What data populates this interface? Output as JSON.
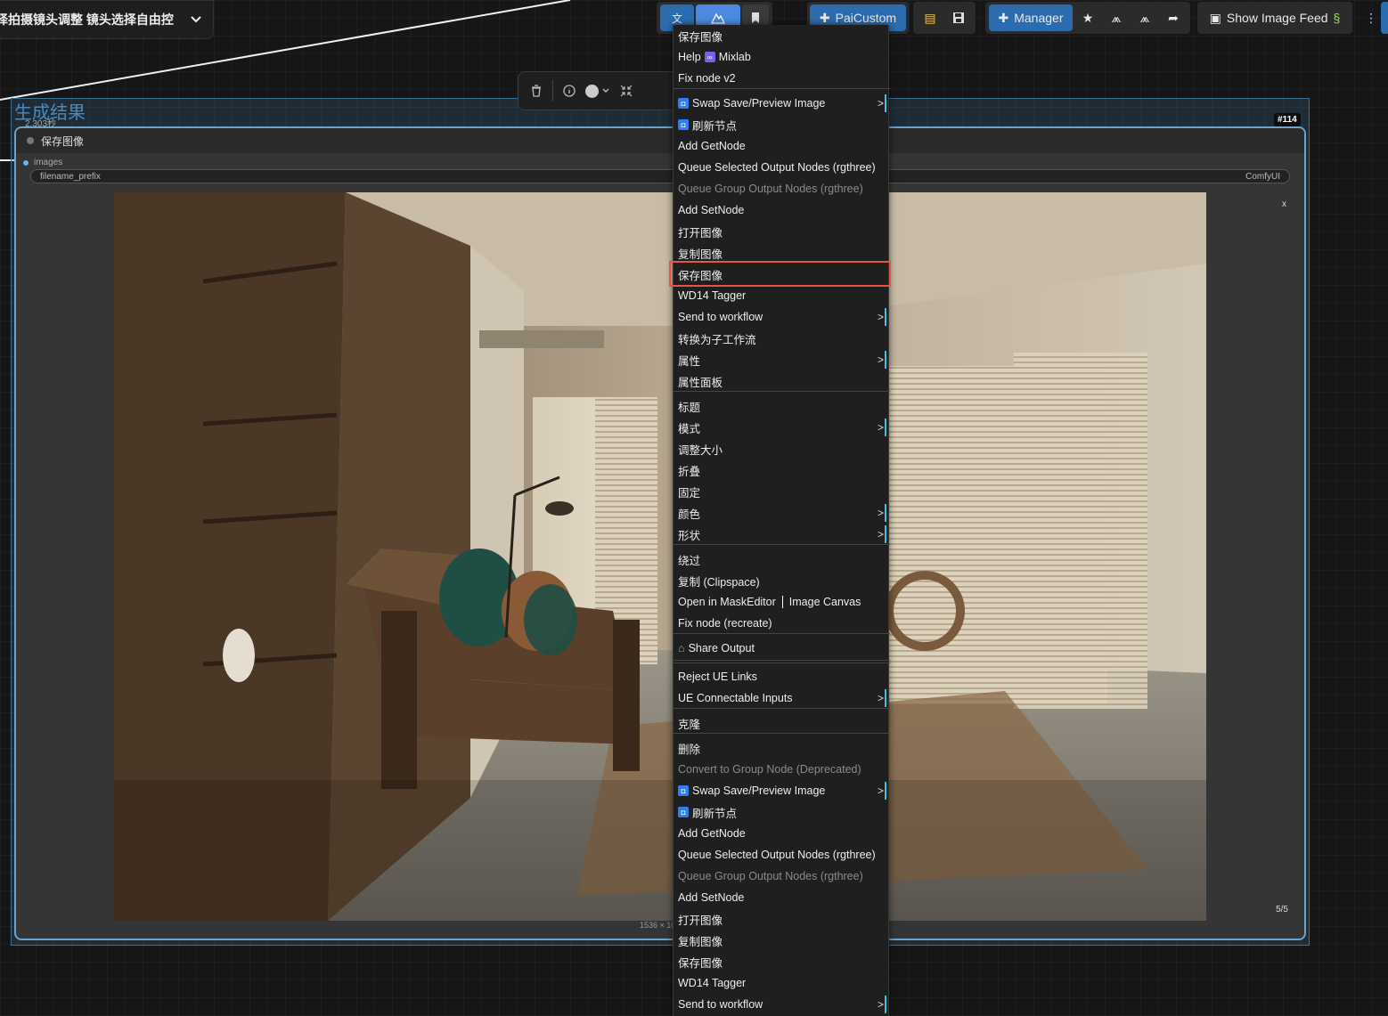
{
  "workflow": {
    "title": "择拍摄镜头调整 镜头选择自由控"
  },
  "toolbar": {
    "translate_icon": "translate-icon",
    "paicustom_label": "PaiCustom",
    "manager_label": "Manager",
    "show_image_feed_label": "Show Image Feed"
  },
  "group": {
    "title": "生成结果",
    "time": "2.303秒"
  },
  "node": {
    "id_badge": "#114",
    "title": "保存图像",
    "input_label": "images",
    "widget_name": "filename_prefix",
    "widget_value": "ComfyUI",
    "close_label": "x",
    "counter": "5/5",
    "image_size": "1536 × 10"
  },
  "menu": {
    "items": [
      {
        "label": "保存图像",
        "disabled": false,
        "submenu": false,
        "icon": null
      },
      {
        "label": "Help",
        "suffix": "Mixlab",
        "disabled": false,
        "submenu": false,
        "icon": "mixlab"
      },
      {
        "label": "Fix node v2",
        "disabled": false,
        "submenu": false,
        "icon": null
      },
      {
        "label": "Swap Save/Preview Image",
        "disabled": false,
        "submenu": true,
        "icon": "blue"
      },
      {
        "label": "刷新节点",
        "disabled": false,
        "submenu": false,
        "icon": "blue"
      },
      {
        "label": "Add GetNode",
        "disabled": false,
        "submenu": false,
        "icon": null
      },
      {
        "label": "Queue Selected Output Nodes (rgthree)",
        "disabled": false,
        "submenu": false,
        "icon": null
      },
      {
        "label": "Queue Group Output Nodes (rgthree)",
        "disabled": true,
        "submenu": false,
        "icon": null
      },
      {
        "label": "Add SetNode",
        "disabled": false,
        "submenu": false,
        "icon": null
      },
      {
        "label": "打开图像",
        "disabled": false,
        "submenu": false,
        "icon": null
      },
      {
        "label": "复制图像",
        "disabled": false,
        "submenu": false,
        "icon": null
      },
      {
        "label": "保存图像",
        "disabled": false,
        "submenu": false,
        "icon": null,
        "highlighted": true
      },
      {
        "label": "WD14 Tagger",
        "disabled": false,
        "submenu": false,
        "icon": null
      },
      {
        "label": "Send to workflow",
        "disabled": false,
        "submenu": true,
        "icon": null
      },
      {
        "label": "转换为子工作流",
        "disabled": false,
        "submenu": false,
        "icon": null
      },
      {
        "label": "属性",
        "disabled": false,
        "submenu": true,
        "icon": null
      },
      {
        "label": "属性面板",
        "disabled": false,
        "submenu": false,
        "icon": null
      },
      {
        "label": "标题",
        "disabled": false,
        "submenu": false,
        "icon": null
      },
      {
        "label": "模式",
        "disabled": false,
        "submenu": true,
        "icon": null
      },
      {
        "label": "调整大小",
        "disabled": false,
        "submenu": false,
        "icon": null
      },
      {
        "label": "折叠",
        "disabled": false,
        "submenu": false,
        "icon": null
      },
      {
        "label": "固定",
        "disabled": false,
        "submenu": false,
        "icon": null
      },
      {
        "label": "颜色",
        "disabled": false,
        "submenu": true,
        "icon": null
      },
      {
        "label": "形状",
        "disabled": false,
        "submenu": true,
        "icon": null
      },
      {
        "label": "绕过",
        "disabled": false,
        "submenu": false,
        "icon": null
      },
      {
        "label": "复制 (Clipspace)",
        "disabled": false,
        "submenu": false,
        "icon": null
      },
      {
        "label": "Open in MaskEditor",
        "suffix": "Image Canvas",
        "disabled": false,
        "submenu": false,
        "icon": "pipe"
      },
      {
        "label": "Fix node (recreate)",
        "disabled": false,
        "submenu": false,
        "icon": null
      },
      {
        "label": "Share Output",
        "disabled": false,
        "submenu": false,
        "icon": "share"
      },
      {
        "label": "Reject UE Links",
        "disabled": false,
        "submenu": false,
        "icon": null
      },
      {
        "label": "UE Connectable Inputs",
        "disabled": false,
        "submenu": true,
        "icon": null
      },
      {
        "label": "克隆",
        "disabled": false,
        "submenu": false,
        "icon": null
      },
      {
        "label": "删除",
        "disabled": false,
        "submenu": false,
        "icon": null
      },
      {
        "label": "Convert to Group Node (Deprecated)",
        "disabled": true,
        "submenu": false,
        "icon": null
      },
      {
        "label": "Swap Save/Preview Image",
        "disabled": false,
        "submenu": true,
        "icon": "blue"
      },
      {
        "label": "刷新节点",
        "disabled": false,
        "submenu": false,
        "icon": "blue"
      },
      {
        "label": "Add GetNode",
        "disabled": false,
        "submenu": false,
        "icon": null
      },
      {
        "label": "Queue Selected Output Nodes (rgthree)",
        "disabled": false,
        "submenu": false,
        "icon": null
      },
      {
        "label": "Queue Group Output Nodes (rgthree)",
        "disabled": true,
        "submenu": false,
        "icon": null
      },
      {
        "label": "Add SetNode",
        "disabled": false,
        "submenu": false,
        "icon": null
      },
      {
        "label": "打开图像",
        "disabled": false,
        "submenu": false,
        "icon": null
      },
      {
        "label": "复制图像",
        "disabled": false,
        "submenu": false,
        "icon": null
      },
      {
        "label": "保存图像",
        "disabled": false,
        "submenu": false,
        "icon": null
      },
      {
        "label": "WD14 Tagger",
        "disabled": false,
        "submenu": false,
        "icon": null
      },
      {
        "label": "Send to workflow",
        "disabled": false,
        "submenu": true,
        "icon": null
      }
    ],
    "submenu_glyph": ">"
  },
  "colors": {
    "accent_blue": "#2b6cb0",
    "highlight_red": "#e5534b",
    "group_border": "#3b6f94",
    "node_border": "#6fa2c9"
  }
}
